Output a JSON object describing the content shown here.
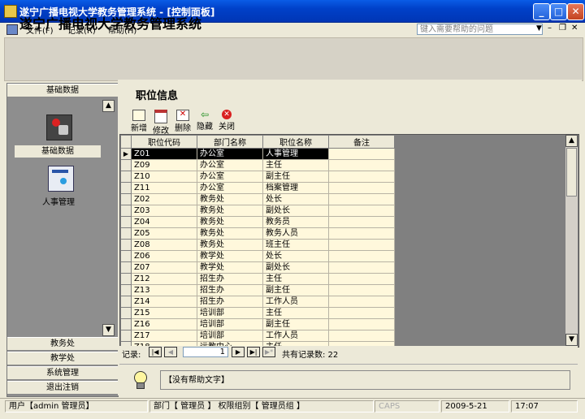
{
  "window": {
    "title": "遂宁广播电视大学教务管理系统 - [控制面板]"
  },
  "menu": {
    "items": [
      "文件(F)",
      "记录(R)",
      "帮助(H)"
    ],
    "help_placeholder": "键入需要帮助的问题"
  },
  "header": {
    "title": "遂宁广播电视大学教务管理系统"
  },
  "sidebar": {
    "top_group": "基础数据",
    "items": [
      "基础数据",
      "人事管理"
    ],
    "bottom_groups": [
      "教务处",
      "教学处",
      "系统管理",
      "退出注销"
    ]
  },
  "section": {
    "title": "职位信息"
  },
  "toolbar": {
    "buttons": [
      "新增",
      "修改",
      "删除",
      "隐藏",
      "关闭"
    ]
  },
  "table": {
    "columns": [
      "职位代码",
      "部门名称",
      "职位名称",
      "备注"
    ],
    "rows": [
      [
        "Z01",
        "办公室",
        "人事管理",
        ""
      ],
      [
        "Z09",
        "办公室",
        "主任",
        ""
      ],
      [
        "Z10",
        "办公室",
        "副主任",
        ""
      ],
      [
        "Z11",
        "办公室",
        "档案管理",
        ""
      ],
      [
        "Z02",
        "教务处",
        "处长",
        ""
      ],
      [
        "Z03",
        "教务处",
        "副处长",
        ""
      ],
      [
        "Z04",
        "教务处",
        "教务员",
        ""
      ],
      [
        "Z05",
        "教务处",
        "教务人员",
        ""
      ],
      [
        "Z08",
        "教务处",
        "班主任",
        ""
      ],
      [
        "Z06",
        "教学处",
        "处长",
        ""
      ],
      [
        "Z07",
        "教学处",
        "副处长",
        ""
      ],
      [
        "Z12",
        "招生办",
        "主任",
        ""
      ],
      [
        "Z13",
        "招生办",
        "副主任",
        ""
      ],
      [
        "Z14",
        "招生办",
        "工作人员",
        ""
      ],
      [
        "Z15",
        "培训部",
        "主任",
        ""
      ],
      [
        "Z16",
        "培训部",
        "副主任",
        ""
      ],
      [
        "Z17",
        "培训部",
        "工作人员",
        ""
      ],
      [
        "Z18",
        "远教中心",
        "主任",
        ""
      ]
    ]
  },
  "record_nav": {
    "label": "记录:",
    "current": "1",
    "total_label": "共有记录数: 22"
  },
  "help": {
    "text": "【没有帮助文字】"
  },
  "status": {
    "user": "用户【admin 管理员】",
    "dept": "部门【 管理员 】 权限组别【 管理员组 】",
    "caps": "CAPS",
    "date": "2009-5-21",
    "time": "17:07"
  }
}
